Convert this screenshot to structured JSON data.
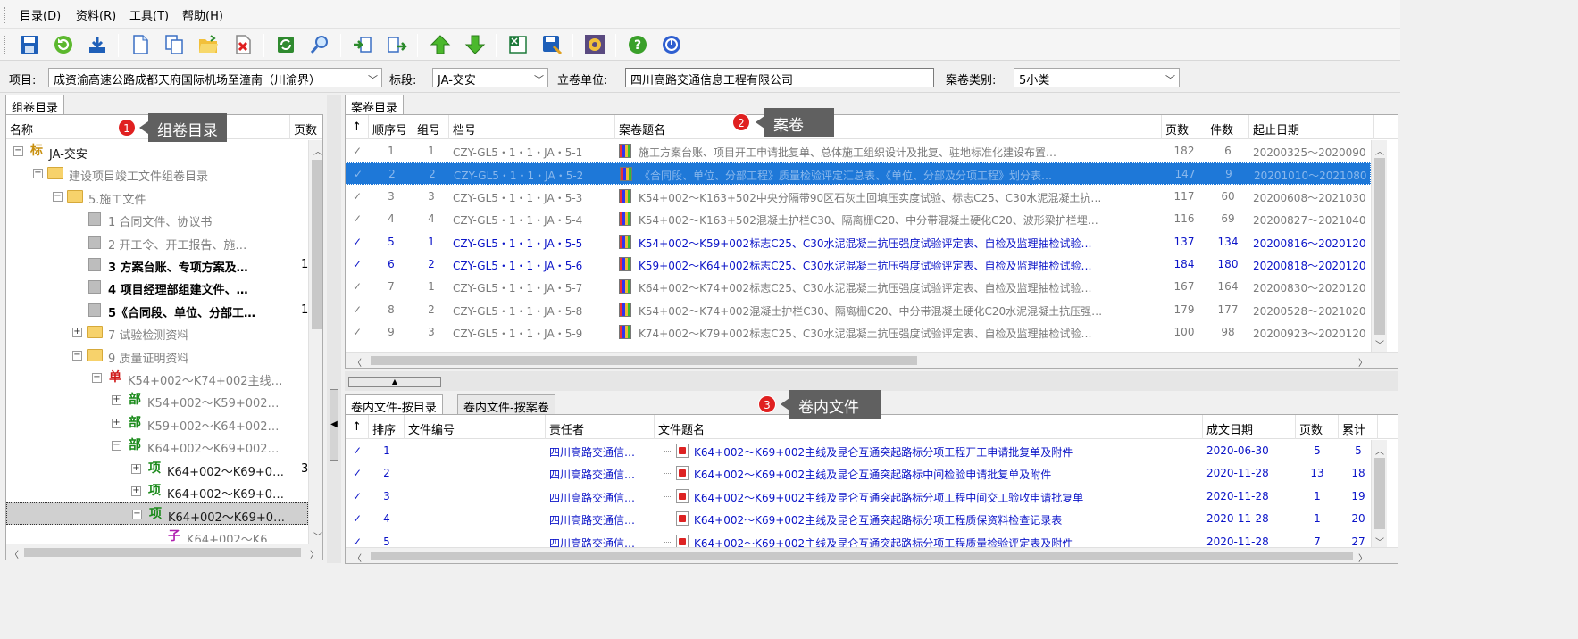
{
  "menu": [
    "目录(D)",
    "资料(R)",
    "工具(T)",
    "帮助(H)"
  ],
  "toolbar_icons": [
    "save-icon",
    "refresh-icon",
    "download-icon",
    "new-doc-icon",
    "copy-icon",
    "open-folder-icon",
    "delete-icon",
    "sync-icon",
    "search-icon",
    "import-icon",
    "export-icon",
    "move-up-icon",
    "move-down-icon",
    "excel-icon",
    "save-as-icon",
    "settings-icon",
    "help-icon",
    "info-icon"
  ],
  "filter": {
    "project_label": "项目:",
    "project_value": "成资渝高速公路成都天府国际机场至潼南（川渝界）",
    "section_label": "标段:",
    "section_value": "JA-交安",
    "unit_label": "立卷单位:",
    "unit_value": "四川高路交通信息工程有限公司",
    "category_label": "案卷类别:",
    "category_value": "5小类"
  },
  "tree_tab": "组卷目录",
  "tree_header": {
    "name": "名称",
    "pages": "页数"
  },
  "tree": [
    {
      "text": "JA-交安",
      "badge": "标",
      "badge_color": "#c89010",
      "indent": 0,
      "exp": "-",
      "style": "dark"
    },
    {
      "text": "建设项目竣工文件组卷目录",
      "icon": "folder",
      "indent": 1,
      "exp": "-",
      "style": "gray"
    },
    {
      "text": "5.施工文件",
      "icon": "folder",
      "indent": 2,
      "exp": "-",
      "style": "gray"
    },
    {
      "text": "1 合同文件、协议书",
      "icon": "doc",
      "indent": 3,
      "style": "gray",
      "pages": ""
    },
    {
      "text": "2 开工令、开工报告、施…",
      "icon": "doc",
      "indent": 3,
      "style": "gray",
      "pages": ""
    },
    {
      "text": "3 方案台账、专项方案及…",
      "icon": "doc",
      "indent": 3,
      "style": "bold",
      "pages": "1"
    },
    {
      "text": "4 项目经理部组建文件、…",
      "icon": "doc",
      "indent": 3,
      "style": "bold",
      "pages": ""
    },
    {
      "text": "5《合同段、单位、分部工…",
      "icon": "doc",
      "indent": 3,
      "style": "bold",
      "pages": "1"
    },
    {
      "text": "7 试验检测资料",
      "icon": "folder",
      "indent": 3,
      "exp": "+",
      "style": "gray"
    },
    {
      "text": "9 质量证明资料",
      "icon": "folder",
      "indent": 3,
      "exp": "-",
      "style": "gray"
    },
    {
      "text": "K54+002～K74+002主线…",
      "badge": "单",
      "badge_color": "#d01818",
      "indent": 4,
      "exp": "-",
      "style": "gray"
    },
    {
      "text": "K54+002～K59+002…",
      "badge": "部",
      "badge_color": "#1a8a1a",
      "indent": 5,
      "exp": "+",
      "style": "gray"
    },
    {
      "text": "K59+002～K64+002…",
      "badge": "部",
      "badge_color": "#1a8a1a",
      "indent": 5,
      "exp": "+",
      "style": "gray"
    },
    {
      "text": "K64+002～K69+002…",
      "badge": "部",
      "badge_color": "#1a8a1a",
      "indent": 5,
      "exp": "-",
      "style": "gray"
    },
    {
      "text": "K64+002～K69+0…",
      "badge": "项",
      "badge_color": "#1a8a1a",
      "indent": 6,
      "exp": "+",
      "style": "dark",
      "pages": "3"
    },
    {
      "text": "K64+002～K69+0…",
      "badge": "项",
      "badge_color": "#1a8a1a",
      "indent": 6,
      "exp": "+",
      "style": "dark"
    },
    {
      "text": "K64+002～K69+0…",
      "badge": "项",
      "badge_color": "#1a8a1a",
      "indent": 6,
      "exp": "-",
      "style": "dark",
      "selected": true
    },
    {
      "text": "K64+002～K6…",
      "badge": "子",
      "badge_color": "#b020b0",
      "indent": 7,
      "style": "gray"
    }
  ],
  "annotations": [
    {
      "num": "1",
      "label": "组卷目录"
    },
    {
      "num": "2",
      "label": "案卷"
    },
    {
      "num": "3",
      "label": "卷内文件"
    }
  ],
  "volume_tab": "案卷目录",
  "volume_columns": [
    "↑",
    "顺序号",
    "组号",
    "档号",
    "案卷题名",
    "页数",
    "件数",
    "起止日期"
  ],
  "volumes": [
    {
      "seq": "1",
      "grp": "1",
      "code": "CZY-GL5・1・1・JA・5-1",
      "title": "施工方案台账、项目开工申请批复单、总体施工组织设计及批复、驻地标准化建设布置…",
      "pages": "182",
      "count": "6",
      "date": "20200325～2020090",
      "style": "gray"
    },
    {
      "seq": "2",
      "grp": "2",
      "code": "CZY-GL5・1・1・JA・5-2",
      "title": "《合同段、单位、分部工程》质量检验评定汇总表、《单位、分部及分项工程》划分表…",
      "pages": "147",
      "count": "9",
      "date": "20201010～2021080",
      "style": "sel"
    },
    {
      "seq": "3",
      "grp": "3",
      "code": "CZY-GL5・1・1・JA・5-3",
      "title": "K54+002～K163+502中央分隔带90区石灰土回填压实度试验、标志C25、C30水泥混凝土抗…",
      "pages": "117",
      "count": "60",
      "date": "20200608～2021030",
      "style": "gray"
    },
    {
      "seq": "4",
      "grp": "4",
      "code": "CZY-GL5・1・1・JA・5-4",
      "title": "K54+002～K163+502混凝土护栏C30、隔离栅C20、中分带混凝土硬化C20、波形梁护栏埋…",
      "pages": "116",
      "count": "69",
      "date": "20200827～2021040",
      "style": "gray"
    },
    {
      "seq": "5",
      "grp": "1",
      "code": "CZY-GL5・1・1・JA・5-5",
      "title": "K54+002～K59+002标志C25、C30水泥混凝土抗压强度试验评定表、自检及监理抽检试验…",
      "pages": "137",
      "count": "134",
      "date": "20200816～2020120",
      "style": "blue"
    },
    {
      "seq": "6",
      "grp": "2",
      "code": "CZY-GL5・1・1・JA・5-6",
      "title": "K59+002～K64+002标志C25、C30水泥混凝土抗压强度试验评定表、自检及监理抽检试验…",
      "pages": "184",
      "count": "180",
      "date": "20200818～2020120",
      "style": "blue"
    },
    {
      "seq": "7",
      "grp": "1",
      "code": "CZY-GL5・1・1・JA・5-7",
      "title": "K64+002～K74+002标志C25、C30水泥混凝土抗压强度试验评定表、自检及监理抽检试验…",
      "pages": "167",
      "count": "164",
      "date": "20200830～2020120",
      "style": "gray"
    },
    {
      "seq": "8",
      "grp": "2",
      "code": "CZY-GL5・1・1・JA・5-8",
      "title": "K54+002～K74+002混凝土护栏C30、隔离栅C20、中分带混凝土硬化C20水泥混凝土抗压强…",
      "pages": "179",
      "count": "177",
      "date": "20200528～2021020",
      "style": "gray"
    },
    {
      "seq": "9",
      "grp": "3",
      "code": "CZY-GL5・1・1・JA・5-9",
      "title": "K74+002～K79+002标志C25、C30水泥混凝土抗压强度试验评定表、自检及监理抽检试验…",
      "pages": "100",
      "count": "98",
      "date": "20200923～2020120",
      "style": "gray"
    }
  ],
  "file_tabs": [
    "卷内文件-按目录",
    "卷内文件-按案卷"
  ],
  "file_columns": [
    "↑",
    "排序",
    "文件编号",
    "责任者",
    "文件题名",
    "成文日期",
    "页数",
    "累计"
  ],
  "files": [
    {
      "order": "1",
      "no": "",
      "owner": "四川高路交通信…",
      "title": "K64+002～K69+002主线及昆仑互通突起路标分项工程开工申请批复单及附件",
      "date": "2020-06-30",
      "pages": "5",
      "total": "5"
    },
    {
      "order": "2",
      "no": "",
      "owner": "四川高路交通信…",
      "title": "K64+002～K69+002主线及昆仑互通突起路标中间检验申请批复单及附件",
      "date": "2020-11-28",
      "pages": "13",
      "total": "18"
    },
    {
      "order": "3",
      "no": "",
      "owner": "四川高路交通信…",
      "title": "K64+002～K69+002主线及昆仑互通突起路标分项工程中间交工验收申请批复单",
      "date": "2020-11-28",
      "pages": "1",
      "total": "19"
    },
    {
      "order": "4",
      "no": "",
      "owner": "四川高路交通信…",
      "title": "K64+002～K69+002主线及昆仑互通突起路标分项工程质保资料检查记录表",
      "date": "2020-11-28",
      "pages": "1",
      "total": "20"
    },
    {
      "order": "5",
      "no": "",
      "owner": "四川高路交通信…",
      "title": "K64+002～K69+002主线及昆仑互通突起路标分项工程质量检验评定表及附件",
      "date": "2020-11-28",
      "pages": "7",
      "total": "27"
    }
  ]
}
